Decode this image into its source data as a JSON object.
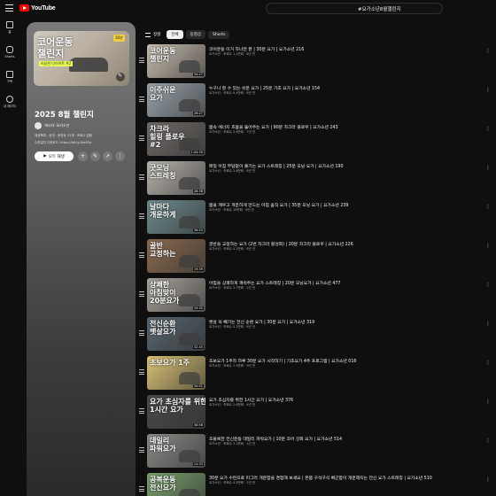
{
  "header": {
    "logo_text": "YouTube",
    "search_value": "#요가소년8월챌린지"
  },
  "rail": [
    {
      "label": "홈",
      "icon": "home-icon"
    },
    {
      "label": "Shorts",
      "icon": "shorts-icon"
    },
    {
      "label": "구독",
      "icon": "subscriptions-icon"
    },
    {
      "label": "내 페이지",
      "icon": "you-icon"
    }
  ],
  "playlist": {
    "thumb_title": "코어운동\n챌린지",
    "thumb_sub": "러닝한 다이어트 #2",
    "thumb_badge": "30분",
    "title": "2025 8월 챌린지",
    "owner": "게시자: 요가소년",
    "meta": "재생목록 · 공개 · 동영상 31개 · 조회수 없음",
    "desc": "수련일지 다운로드: https://bit.ly/4seE5p",
    "play_all": "모두 재생"
  },
  "sort": {
    "label": "정렬",
    "chips": [
      "전체",
      "동영상",
      "Shorts"
    ],
    "active": 0
  },
  "videos": [
    {
      "title": "코어운동 이거 하나면 끝 | 30분 요가 | 요가소년 216",
      "meta": "요가소년 · 조회수 1.1만회 · 8년 전",
      "dur": "34:27",
      "cap": "코어운동\n챌린지",
      "bg": "#c7bdaf"
    },
    {
      "title": "누구나 할 수 있는 쉬운 요가 | 25분 기초 요가 | 요가소년 154",
      "meta": "요가소년 · 조회수 9.4만회 · 8년 전",
      "dur": "26:27",
      "cap": "이주쉬운\n요가",
      "bg": "#9aa4ac"
    },
    {
      "title": "몸속 에너지 흐름을 뚫어주는 요가 | 90분 차크라 플로우 | 요가소년 243",
      "meta": "요가소년 · 조회수 2.6만회 · 7년 전",
      "dur": "1:04:30",
      "cap": "차크라\n힐링 플로우\n#2",
      "bg": "#6f6a66"
    },
    {
      "title": "매일 아침 부담없이 즐기는 요가 스트레칭 | 25분 모닝 요가 | 요가소년 190",
      "meta": "요가소년 · 조회수 3.8만회 · 8년 전",
      "dur": "26:38",
      "cap": "굿모닝\n스트레칭",
      "bg": "#b9b5ad"
    },
    {
      "title": "몸을 깨우고 개운하게 만드는 아침 움직 요가 | 35분 모닝 요가 | 요가소년 239",
      "meta": "요가소년 · 조회수 16만회 · 6년 전",
      "dur": "36:53",
      "cap": "날마다\n개운하게",
      "bg": "#6d8a8c"
    },
    {
      "title": "골반을 교정하는 요가 (2번 차크라 활성화) | 20분 차크라 플로우 | 요가소년 226",
      "meta": "요가소년 · 조회수 5.2만회 · 8년 전",
      "dur": "19:39",
      "cap": "골반\n교정하는",
      "bg": "#8a6a4e"
    },
    {
      "title": "아침을 상쾌하게 깨워주는 요가 스트레칭 | 20분 모닝요가 | 요가소년 477",
      "meta": "요가소년 · 조회수 3.7만회 · 2년 전",
      "dur": "19:32",
      "cap": "상쾌한\n아침맞이\n20분요가",
      "bg": "#a8a39b"
    },
    {
      "title": "뱃살 쏙 빼기는 전신 순환 요가 | 30분 요가 | 요가소년 319",
      "meta": "요가소년 · 조회수 5.2만회 · 6년 전",
      "dur": "32:45",
      "cap": "전신순환\n뱃살요가",
      "bg": "#57646e"
    },
    {
      "title": "초보요가 1주차 하루 30분 요가 시작하기 | 기초요가 4주 프로그램 | 요가소년 016",
      "meta": "요가소년 · 조회수 7.9만회 · 9년 전",
      "dur": "30:01",
      "cap": "초보요가 1주",
      "bg": "#d9c274"
    },
    {
      "title": "요가 초심자를 위한 1시간 요가 | 요가소년 376",
      "meta": "요가소년 · 조회수 2.6만회 · 4년 전",
      "dur": "58:56",
      "cap": "요가 초심자를 위한\n1시간 요가",
      "bg": "#4a4a4a"
    },
    {
      "title": "초플록한 전신운동 데일리 파워요가 | 10분 코어 강화 요가 | 요가소년 514",
      "meta": "요가소년 · 조회수 3.1만회 · 1년 전",
      "dur": "14:33",
      "cap": "데일리\n파워요가",
      "bg": "#8a8a86"
    },
    {
      "title": "30분 요가 수련으로 피그러 개운함을 경험해 보세요 | 온몸 구석구석 뻐근함이 개운해지는 전신 요가 스트레칭 | 요가소년 510",
      "meta": "요가소년 · 조회수 4.5만회 · 1년 전",
      "dur": "31:10",
      "cap": "공복운동\n전신요가",
      "bg": "#79a06b"
    }
  ]
}
